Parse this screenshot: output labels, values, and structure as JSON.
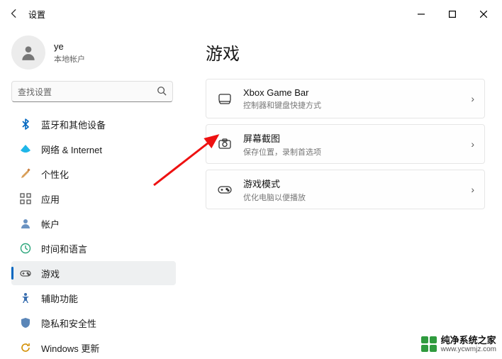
{
  "window": {
    "title": "设置"
  },
  "user": {
    "name": "ye",
    "subtitle": "本地帐户"
  },
  "search": {
    "placeholder": "查找设置"
  },
  "sidebar": {
    "items": [
      {
        "label": "蓝牙和其他设备",
        "icon": "bluetooth-icon",
        "color": "#0067c0"
      },
      {
        "label": "网络 & Internet",
        "icon": "wifi-icon",
        "color": "#00a4ef"
      },
      {
        "label": "个性化",
        "icon": "brush-icon",
        "color": "#c77b3a"
      },
      {
        "label": "应用",
        "icon": "apps-icon",
        "color": "#555"
      },
      {
        "label": "帐户",
        "icon": "account-icon",
        "color": "#4a7ab0"
      },
      {
        "label": "时间和语言",
        "icon": "time-language-icon",
        "color": "#2aa57a"
      },
      {
        "label": "游戏",
        "icon": "gaming-icon",
        "color": "#555",
        "selected": true
      },
      {
        "label": "辅助功能",
        "icon": "accessibility-icon",
        "color": "#3a6fb0"
      },
      {
        "label": "隐私和安全性",
        "icon": "privacy-icon",
        "color": "#4a7ab0"
      },
      {
        "label": "Windows 更新",
        "icon": "update-icon",
        "color": "#d38e00"
      }
    ]
  },
  "page": {
    "title": "游戏",
    "cards": [
      {
        "title": "Xbox Game Bar",
        "subtitle": "控制器和键盘快捷方式",
        "icon": "xbox-icon"
      },
      {
        "title": "屏幕截图",
        "subtitle": "保存位置，录制首选项",
        "icon": "capture-icon"
      },
      {
        "title": "游戏模式",
        "subtitle": "优化电脑以便播放",
        "icon": "gamemode-icon"
      }
    ]
  },
  "watermark": {
    "line1": "纯净系统之家",
    "line2": "www.ycwmjz.com"
  }
}
